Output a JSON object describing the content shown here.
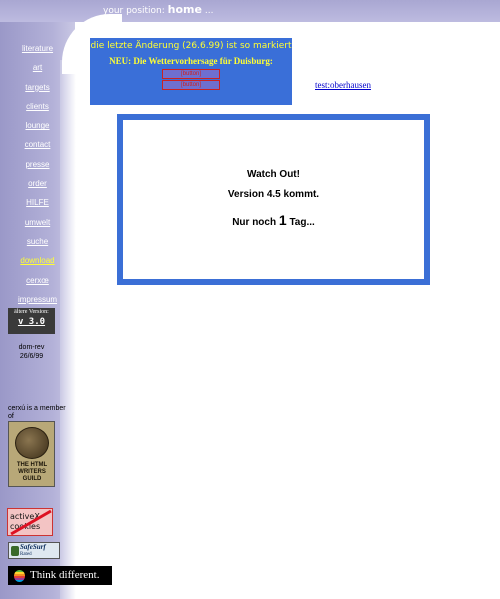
{
  "header": {
    "position_label": "your position:",
    "position_value": "home",
    "ellipsis": "..."
  },
  "nav": {
    "items": [
      {
        "label": "literature"
      },
      {
        "label": "art"
      },
      {
        "label": "targets"
      },
      {
        "label": "clients"
      },
      {
        "label": "lounge"
      },
      {
        "label": "contact"
      },
      {
        "label": "presse"
      },
      {
        "label": "order"
      },
      {
        "label": "HILFE"
      },
      {
        "label": "umwelt"
      },
      {
        "label": "suche"
      },
      {
        "label": "download",
        "active": true
      },
      {
        "label": "cerxœ"
      },
      {
        "label": "impressum"
      }
    ]
  },
  "old_version": {
    "label": "ältere Version:",
    "version": "v 3.0"
  },
  "dom_rev": {
    "line1": "dom-rev",
    "line2": "26/6/99"
  },
  "member": {
    "text": "cerxú is a member of",
    "badge_text": "THE HTML WRITERS GUILD"
  },
  "badges": {
    "noactivex_line1": "activeX",
    "noactivex_line2": "cookies",
    "safesurf": "SafeSurf",
    "safesurf_sub": "Rated",
    "think": "Think different."
  },
  "announce": {
    "line1": "die letzte Änderung (26.6.99) ist so markiert",
    "line2": "NEU: Die Wettervorhersage für Duisburg:",
    "button1": "[button]",
    "button2": "[button]"
  },
  "links": {
    "test": "test:oberhausen"
  },
  "watch": {
    "title": "Watch Out!",
    "version": "Version 4.5 kommt.",
    "prefix": "Nur noch",
    "count": "1",
    "suffix": "Tag..."
  },
  "colors": {
    "sidebar": "#9a98c8",
    "announce_bg": "#3a6fd8",
    "accent_yellow": "#ffff33",
    "box_border": "#3b6fd6",
    "link": "#0000cc"
  }
}
